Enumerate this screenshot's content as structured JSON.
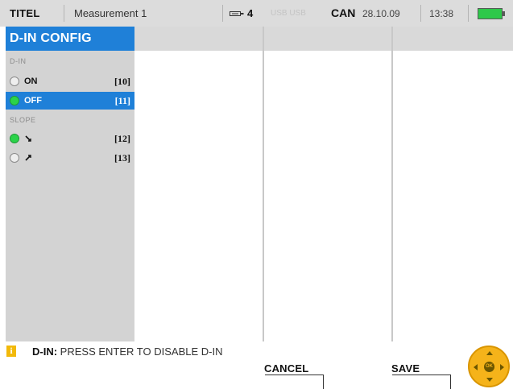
{
  "status_bar": {
    "app_name": "TITEL",
    "measurement": "Measurement 1",
    "channel_count": "4",
    "usb_status": "USB USB",
    "bus": "CAN",
    "date": "28.10.09",
    "time": "13:38",
    "battery_color": "#2ec84a"
  },
  "panel": {
    "title": "D-IN CONFIG",
    "accent_color": "#1f80d8",
    "sections": [
      {
        "label": "D-IN",
        "options": [
          {
            "label": "ON",
            "key": "[10]",
            "selected": false,
            "checked": false
          },
          {
            "label": "OFF",
            "key": "[11]",
            "selected": true,
            "checked": true
          }
        ]
      },
      {
        "label": "SLOPE",
        "options": [
          {
            "icon": "falling-edge-icon",
            "key": "[12]",
            "selected": false,
            "checked": true
          },
          {
            "icon": "rising-edge-icon",
            "key": "[13]",
            "selected": false,
            "checked": false
          }
        ]
      }
    ]
  },
  "info": {
    "icon": "info-icon",
    "key": "D-IN:",
    "message": "PRESS ENTER TO DISABLE D-IN"
  },
  "softkeys": {
    "cancel": "CANCEL",
    "save": "SAVE"
  },
  "joystick": {
    "center_label": "OK",
    "icon": "ok-joystick-icon"
  }
}
